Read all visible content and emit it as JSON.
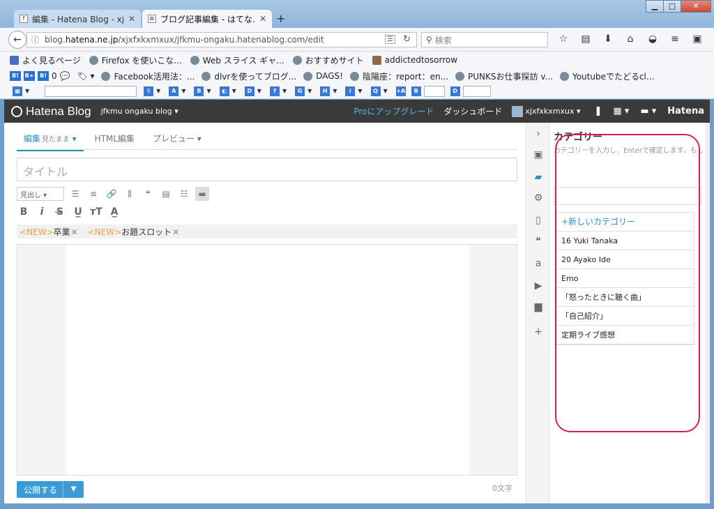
{
  "browser": {
    "tabs": [
      {
        "label": "編集 - Hatena Blog - xj...",
        "active": false
      },
      {
        "label": "ブログ記事編集 - はてな...",
        "active": true
      }
    ],
    "url_prefix": "blog.",
    "url_domain": "hatena.ne.jp",
    "url_path": "/xjxfxkxmxux/jfkmu-ongaku.hatenablog.com/edit",
    "search_placeholder": "検索",
    "bookmarks": [
      "よく見るページ",
      "Firefox を使いこな...",
      "Web スライス ギャ...",
      "おすすめサイト",
      "addictedtosorrow"
    ],
    "toolbar_items": [
      "0",
      "Facebook活用法：...",
      "dlvrを使ってブログ...",
      "DAGS!",
      "陰陽座：report：en...",
      "PUNKSお仕事探訪 v...",
      "Youtubeでたどるcl..."
    ]
  },
  "header": {
    "logo": "Hatena Blog",
    "blog_name": "jfkmu ongaku blog ▾",
    "pro_link": "Proにアップグレード",
    "dashboard": "ダッシュボード",
    "user": "xjxfxkxmxux ▾",
    "brand": "Hatena"
  },
  "editor": {
    "tabs": [
      {
        "label": "編集",
        "sub": "見たまま"
      },
      {
        "label": "HTML編集",
        "sub": ""
      },
      {
        "label": "プレビュー",
        "sub": ""
      }
    ],
    "title_placeholder": "タイトル",
    "heading_select": "見出し",
    "tags": [
      {
        "badge": "<NEW>",
        "label": "卒業"
      },
      {
        "badge": "<NEW>",
        "label": "お題スロット"
      }
    ],
    "publish_label": "公開する",
    "char_count": "0文字"
  },
  "category": {
    "title": "カテゴリー",
    "help": "カテゴリーを入力し、Enterで確定します。もしくは、カテゴリーリストから選んでクリックしてください。",
    "add_label": "+新しいカテゴリー",
    "items": [
      "16 Yuki Tanaka",
      "20 Ayako Ide",
      "Emo",
      "「怒ったときに聴く曲」",
      "「自己紹介」",
      "定期ライブ感想"
    ]
  },
  "colors": {
    "accent": "#2a8fc6",
    "header_bg": "#3a3a3a",
    "annotation": "#d81b60",
    "new_badge": "#e8a23a"
  }
}
